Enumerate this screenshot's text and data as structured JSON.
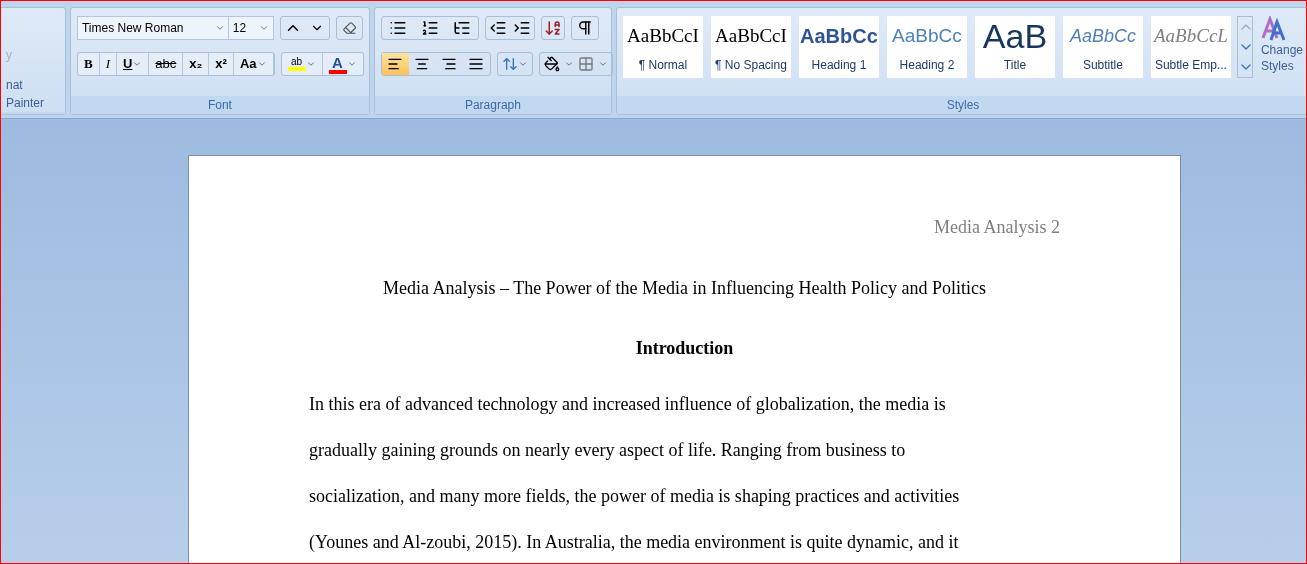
{
  "clipboard": {
    "items": [
      "y",
      "nat Painter"
    ]
  },
  "font": {
    "name": "Times New Roman",
    "size": "12",
    "label": "Font",
    "buttons": [
      {
        "kind": "bold",
        "text": "B"
      },
      {
        "kind": "italic",
        "text": "I"
      },
      {
        "kind": "underline",
        "text": "U",
        "menu": true
      },
      {
        "kind": "strike",
        "text": "abc"
      },
      {
        "kind": "plain",
        "text": "x₂"
      },
      {
        "kind": "plain",
        "text": "x²"
      },
      {
        "kind": "plain",
        "text": "Aa",
        "menu": true
      }
    ],
    "highlight": {
      "text": "ab",
      "color": "#ffff00"
    },
    "font_color": {
      "text": "A",
      "color": "#ff0000"
    }
  },
  "paragraph": {
    "label": "Paragraph",
    "alignments": [
      {
        "kind": "left",
        "selected": true
      },
      {
        "kind": "center",
        "selected": false
      },
      {
        "kind": "right",
        "selected": false
      },
      {
        "kind": "justify",
        "selected": false
      }
    ]
  },
  "styles": {
    "label": "Styles",
    "items": [
      {
        "sample": "AaBbCcI",
        "name": "¶ Normal",
        "kind": "normal"
      },
      {
        "sample": "AaBbCcI",
        "name": "¶ No Spacing",
        "kind": "normal"
      },
      {
        "sample": "AaBbCc",
        "name": "Heading 1",
        "kind": "heading1"
      },
      {
        "sample": "AaBbCc",
        "name": "Heading 2",
        "kind": "heading2"
      },
      {
        "sample": "AaB",
        "name": "Title",
        "kind": "title"
      },
      {
        "sample": "AaBbCc",
        "name": "Subtitle",
        "kind": "subtitle"
      },
      {
        "sample": "AaBbCcL",
        "name": "Subtle Emp...",
        "kind": "emphasis"
      }
    ],
    "change_styles": [
      "Change",
      "Styles"
    ]
  },
  "document": {
    "header": "Media Analysis 2",
    "title": "Media Analysis – The Power of the Media in Influencing Health Policy and Politics",
    "heading": "Introduction",
    "lines": [
      "In this era of advanced technology and increased influence of globalization, the media is",
      "gradually gaining grounds on nearly every aspect of life. Ranging from business to",
      "socialization, and many more fields, the power of media is shaping practices and activities",
      "(Younes and Al-zoubi, 2015). In Australia, the media environment is quite dynamic, and it"
    ]
  }
}
